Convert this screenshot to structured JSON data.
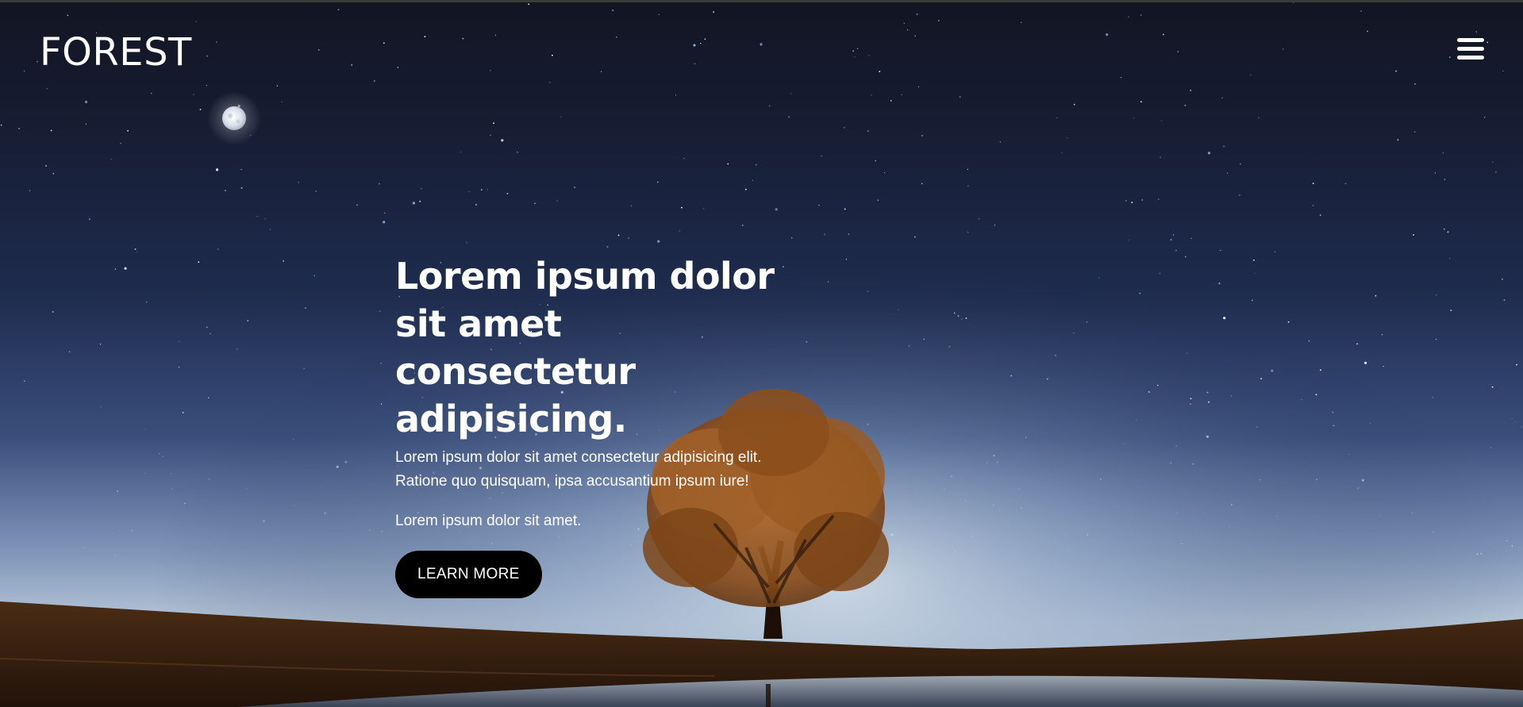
{
  "header": {
    "logo_text": "FOREST",
    "menu_icon": "hamburger-menu-icon"
  },
  "hero": {
    "heading": "Lorem ipsum dolor sit amet consectetur adipisicing.",
    "description": "Lorem ipsum dolor sit amet consectetur adipisicing elit. Ratione quo quisquam, ipsa accusantium ipsum iure!",
    "subtext": "Lorem ipsum dolor sit amet.",
    "cta_label": "LEARN MORE"
  },
  "colors": {
    "sky_top": "#141726",
    "sky_mid": "#243359",
    "sky_horizon": "#b7c7d8",
    "ground": "#3b2412",
    "tree_foliage": "#9a5a22",
    "button_bg": "#000000",
    "text": "#ffffff"
  }
}
